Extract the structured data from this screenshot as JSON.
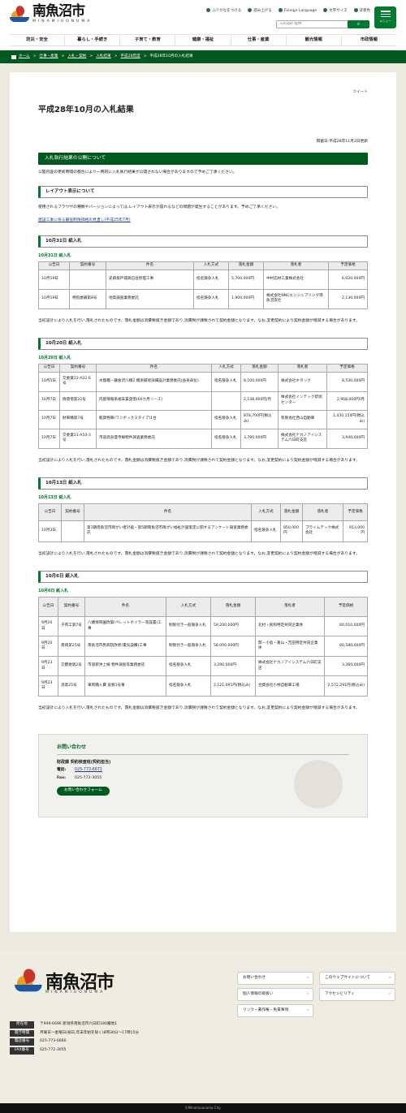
{
  "header": {
    "logo": "南魚沼市",
    "logo_sub": "MINAMIUONUMA",
    "util": [
      {
        "icon": "book-icon",
        "label": "ふりがなをつける"
      },
      {
        "icon": "speaker-icon",
        "label": "読み上げる"
      },
      {
        "icon": "globe-icon",
        "label": "Foreign Language"
      },
      {
        "icon": "text-size-icon",
        "label": "文字サイズ"
      },
      {
        "icon": "palette-icon",
        "label": "背景色"
      }
    ],
    "search_label": "Google 提供",
    "menu_label": "メニュー",
    "nav": [
      "防災・安全",
      "暮らし・手続き",
      "子育て・教育",
      "健康・福祉",
      "仕事・産業",
      "観光情報",
      "市政情報"
    ]
  },
  "breadcrumb": [
    "ホーム",
    "仕事・産業",
    "入札・契約",
    "入札結果",
    "平成28年度",
    "平成28年10月の入札結果"
  ],
  "tweet": "ツイート",
  "title": "平成28年10月の入札結果",
  "published": "掲載日:平成28年11月2日更新",
  "sec1": "入札執行結果の公開について",
  "p1": "公開内容の更新時間の都合により一時的に入札執行結果が公開されない場合がありますので予めご了承ください。",
  "box1": "レイアウト表示について",
  "p2": "使用されるブラウザの種類やバージョンによっては,レイアウト表示が崩れるなどの問題が発生することがあります。予めご了承ください。",
  "link1": "建設工事に係る最低制限価格の見直し(平成25年7月)",
  "note": "当初設計により入札を行い,落札されたものです。落札金額は消費税抜き金額であり,消費税が課税されて契約金額となります。なお,変更契約により契約金額が増減する場合があります。",
  "h_day": "公告日",
  "h_no": "契約番号",
  "h_item": "件名",
  "h_method": "入札方式",
  "h_amount": "落札金額",
  "h_winner": "落札者",
  "h_est": "予定価格",
  "s1": {
    "box": "10月31日 紙入札",
    "sub": "10月31日 紙入札",
    "rows": [
      [
        "10月19日",
        "",
        "史跡坂戸城跡石垣修理工事",
        "指名競争入札",
        "5,700,000円",
        "中村石材工業株式会社",
        "6,020,000円"
      ],
      [
        "10月19日",
        "特指委補第8号",
        "地質調査業務委託",
        "指名競争入札",
        "1,900,000円",
        "株式会社NNCエンジニアリング南魚沼支社",
        "2,130,000円"
      ]
    ]
  },
  "s2": {
    "box": "10月20日 紙入札",
    "sub": "10月20日 紙入札",
    "rows": [
      [
        "10月5日",
        "交委業12-A22-6号",
        "水無橋・鎌倉沢川橋2 橋梁補修詳細設計業務委託(長寿命化)",
        "指名競争入札",
        "8,100,000円",
        "株式会社キタック",
        "8,530,000円"
      ],
      [
        "10月7日",
        "情資借第22号",
        "内部情報系端末賃貸借(60カ月リース)",
        "",
        "2,138,000円/月",
        "株式会社インテック新潟センター",
        "2,968,000円/月"
      ],
      [
        "10月7日",
        "財車購第7号",
        "軽貨物車(ワンボックスタイプ)1台",
        "指名競争入札",
        "878,700円(税込み)",
        "有限会社西山自動車",
        "1,430,154円(税込み)"
      ],
      [
        "10月7日",
        "交委業11-A54-3号",
        "市道高泉盛寺線物件調査業務委託",
        "指名競争入札",
        "3,780,000円",
        "株式会社ナカノアイシステム六日町支店",
        "3,940,000円"
      ]
    ]
  },
  "s3": {
    "box": "10月13日 紙入札",
    "sub": "10月13日 紙入札",
    "rows": [
      [
        "10月3日",
        "",
        "第3期南魚沼市障がい者計画・第5期南魚沼市障がい福祉計画策定に関するアンケート調査業務委託",
        "指名競争入札",
        "850,000円",
        "プライムテック株式会社",
        "913,000円"
      ]
    ]
  },
  "s4": {
    "box": "10月6日 紙入札",
    "sub": "10月6日 紙入札",
    "rows": [
      [
        "9月20日",
        "子育工第7号",
        "八幡保育園改築(ペレットボイラー等設置)工事",
        "制限付き一般競争入札",
        "59,200,000円",
        "北村・創和特定共同企業体",
        "60,010,000円"
      ],
      [
        "9月20日",
        "南病第25号",
        "南魚沼市民病院改修(電気設備)工事",
        "制限付き一般競争入札",
        "58,000,000円",
        "関・小島・嘉山・吉田特定共同企業体",
        "60,580,000円"
      ],
      [
        "9月23日",
        "交都委第2号",
        "市道新沖上線 物件調査等業務委託",
        "指名競争入札",
        "3,290,000円",
        "株式会社ナカノアイシステム六日町支店",
        "3,360,000円"
      ],
      [
        "9月23日",
        "消第25号",
        "車両購入費 査察1号車",
        "指名競争入札",
        "2,121,091円(税込み)",
        "合資会社小林自動車工場",
        "2,572,291円(税込み)"
      ]
    ]
  },
  "contact": {
    "title": "お問い合わせ",
    "dept": "財政課 契約検査班(契約担当)",
    "tel_k": "電話:",
    "tel": "025-773-6671",
    "fax_k": "Fax:",
    "fax": "025-772-3055",
    "btn": "お問い合わせフォーム"
  },
  "footer": {
    "logo": "南魚沼市",
    "logo_sub": "MINAMIUONUMA",
    "links": [
      "お問い合わせ",
      "このウェブサイトについて",
      "個人情報の取扱い",
      "アクセシビリティ",
      "リンク・著作権・免責事項"
    ],
    "info": [
      [
        "所在地",
        "〒949-6696 新潟県南魚沼市六日町180番地1"
      ],
      [
        "開庁時間",
        "月曜日～金曜日(祝日,年末年始を除く)8時30分～17時15分"
      ],
      [
        "電話番号",
        "025-773-6660"
      ],
      [
        "FAX番号",
        "025-772-3055"
      ]
    ],
    "copy": "©Minamiuonuma City."
  },
  "colors": {
    "brand": "#005a20",
    "accent": "#007a2e"
  }
}
